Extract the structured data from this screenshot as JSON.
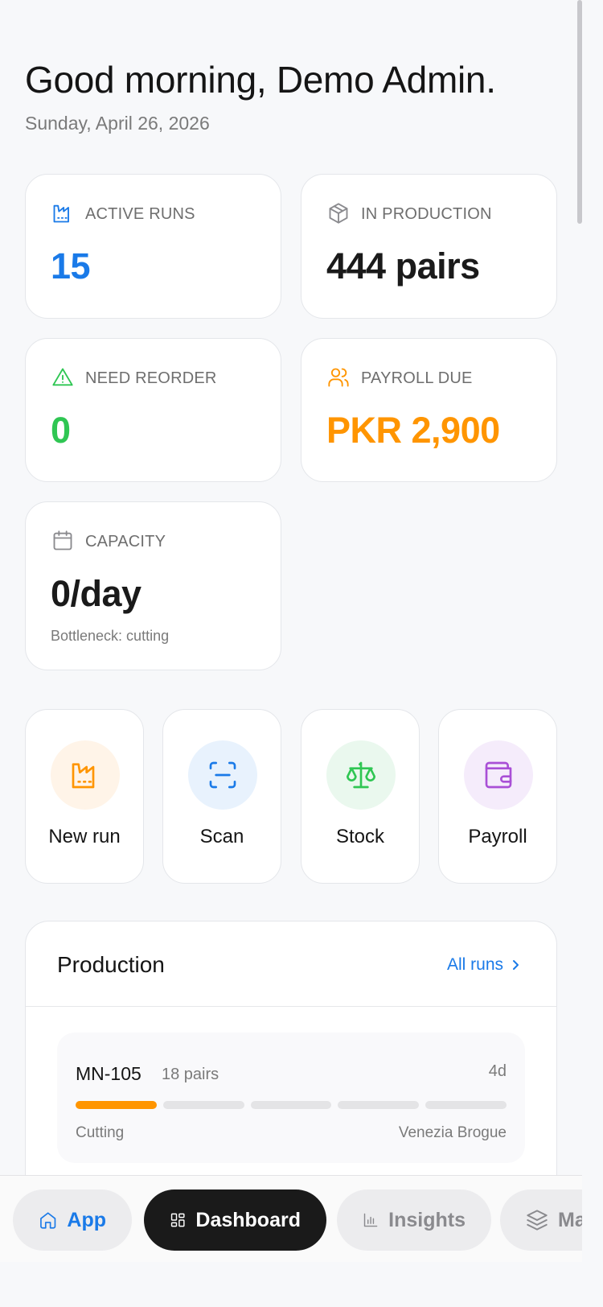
{
  "header": {
    "greeting": "Good morning, Demo Admin.",
    "date": "Sunday, April 26, 2026"
  },
  "stats": {
    "active_runs": {
      "label": "ACTIVE RUNS",
      "value": "15",
      "color": "#1a7ae8",
      "icon": "factory-icon"
    },
    "in_production": {
      "label": "IN PRODUCTION",
      "value": "444 pairs",
      "color": "#1a1a1a",
      "icon": "box-icon"
    },
    "need_reorder": {
      "label": "NEED REORDER",
      "value": "0",
      "color": "#2fc653",
      "icon": "alert-triangle-icon"
    },
    "payroll_due": {
      "label": "PAYROLL DUE",
      "value": "PKR 2,900",
      "color": "#ff9500",
      "icon": "users-icon"
    },
    "capacity": {
      "label": "CAPACITY",
      "value": "0/day",
      "sub": "Bottleneck: cutting",
      "color": "#1a1a1a",
      "icon": "calendar-icon"
    }
  },
  "actions": [
    {
      "label": "New run",
      "icon": "factory-icon",
      "color": "#ff9500",
      "bg": "#fff4e8"
    },
    {
      "label": "Scan",
      "icon": "scan-icon",
      "color": "#1a7ae8",
      "bg": "#e8f2fd"
    },
    {
      "label": "Stock",
      "icon": "scale-icon",
      "color": "#2fc653",
      "bg": "#eaf8ee"
    },
    {
      "label": "Payroll",
      "icon": "wallet-icon",
      "color": "#a94fd6",
      "bg": "#f5ecfb"
    }
  ],
  "production": {
    "title": "Production",
    "link": "All runs",
    "runs": [
      {
        "code": "MN-105",
        "pairs": "18 pairs",
        "age": "4d",
        "stage": "Cutting",
        "model": "Venezia Brogue",
        "progress_stages_done": 1,
        "progress_stages_total": 5
      }
    ]
  },
  "bottom_nav": [
    {
      "label": "App",
      "icon": "home-icon",
      "active": false
    },
    {
      "label": "Dashboard",
      "icon": "grid-icon",
      "active": true
    },
    {
      "label": "Insights",
      "icon": "bar-chart-icon",
      "active": false
    },
    {
      "label": "Ma",
      "icon": "layers-icon",
      "active": false
    }
  ]
}
